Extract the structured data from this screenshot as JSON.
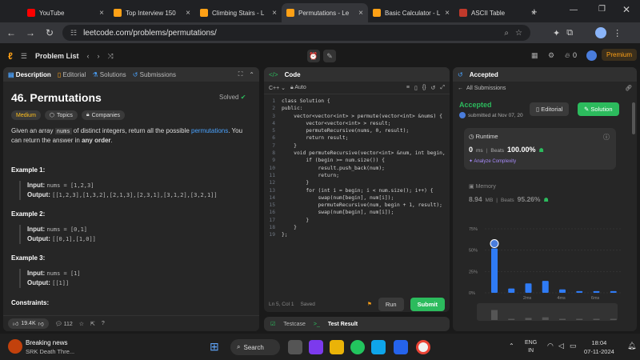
{
  "browser": {
    "tabs": [
      {
        "label": "YouTube",
        "color": "#ff0000"
      },
      {
        "label": "Top Interview 150",
        "color": "#ffa116"
      },
      {
        "label": "Climbing Stairs - L",
        "color": "#ffa116"
      },
      {
        "label": "Permutations - Le",
        "color": "#ffa116"
      },
      {
        "label": "Basic Calculator - L",
        "color": "#ffa116"
      },
      {
        "label": "ASCII Table",
        "color": "#c0392b"
      }
    ],
    "url": "leetcode.com/problems/permutations/"
  },
  "lc_nav": {
    "problem_list": "Problem List",
    "fire_count": "0",
    "premium": "Premium"
  },
  "left_panel": {
    "tabs": [
      "Description",
      "Editorial",
      "Solutions",
      "Submissions"
    ],
    "title": "46. Permutations",
    "solved": "Solved",
    "difficulty": "Medium",
    "chips": [
      "Topics",
      "Companies"
    ],
    "desc_pre": "Given an array",
    "desc_code": "nums",
    "desc_mid": "of distinct integers, return all the possible",
    "desc_link": "permutations",
    "desc_post": ". You can return the answer in",
    "desc_bold": "any order",
    "desc_end": ".",
    "examples": [
      {
        "heading": "Example 1:",
        "input": "nums = [1,2,3]",
        "output": "[[1,2,3],[1,3,2],[2,1,3],[2,3,1],[3,1,2],[3,2,1]]"
      },
      {
        "heading": "Example 2:",
        "input": "nums = [0,1]",
        "output": "[[0,1],[1,0]]"
      },
      {
        "heading": "Example 3:",
        "input": "nums = [1]",
        "output": "[[1]]"
      }
    ],
    "input_label": "Input:",
    "output_label": "Output:",
    "constraints": "Constraints:",
    "likes": "19.4K",
    "comments": "112"
  },
  "code_panel": {
    "title": "Code",
    "language": "C++",
    "auto": "Auto",
    "lines": [
      "class Solution {",
      "public:",
      "    vector<vector<int> > permute(vector<int> &nums) {",
      "        vector<vector<int> > result;",
      "        permuteRecursive(nums, 0, result);",
      "        return result;",
      "    }",
      "    void permuteRecursive(vector<int> &num, int begin,",
      "        if (begin >= num.size()) {",
      "            result.push_back(num);",
      "            return;",
      "        }",
      "        for (int i = begin; i < num.size(); i++) {",
      "            swap(num[begin], num[i]);",
      "            permuteRecursive(num, begin + 1, result);",
      "            swap(num[begin], num[i]);",
      "        }",
      "    }",
      "};"
    ],
    "status": "Ln 5, Col 1",
    "saved": "Saved",
    "run": "Run",
    "submit": "Submit",
    "testcase": "Testcase",
    "test_result": "Test Result"
  },
  "accepted_panel": {
    "title": "Accepted",
    "all_submissions": "All Submissions",
    "status": "Accepted",
    "submitted": "submitted at Nov 07, 20",
    "editorial": "Editorial",
    "solution": "Solution",
    "runtime_label": "Runtime",
    "runtime_value": "0",
    "runtime_unit": "ms",
    "beats_label": "Beats",
    "runtime_beats": "100.00%",
    "analyze": "Analyze Complexity",
    "memory_label": "Memory",
    "memory_value": "8.94",
    "memory_unit": "MB",
    "memory_beats": "95.26%"
  },
  "chart_data": {
    "type": "bar",
    "ytick_labels": [
      "75%",
      "50%",
      "25%",
      "0%"
    ],
    "ylim": [
      0,
      75
    ],
    "x_labels": [
      "2ms",
      "4ms",
      "6ms"
    ],
    "values": [
      52,
      5,
      11,
      14,
      4,
      2,
      2,
      2
    ],
    "highlight_index": 0,
    "bar_color": "#2f7bf5"
  },
  "taskbar": {
    "news_title": "Breaking news",
    "news_sub": "SRK Death Thre...",
    "search": "Search",
    "lang1": "ENG",
    "lang2": "IN",
    "time": "18:04",
    "date": "07-11-2024"
  }
}
